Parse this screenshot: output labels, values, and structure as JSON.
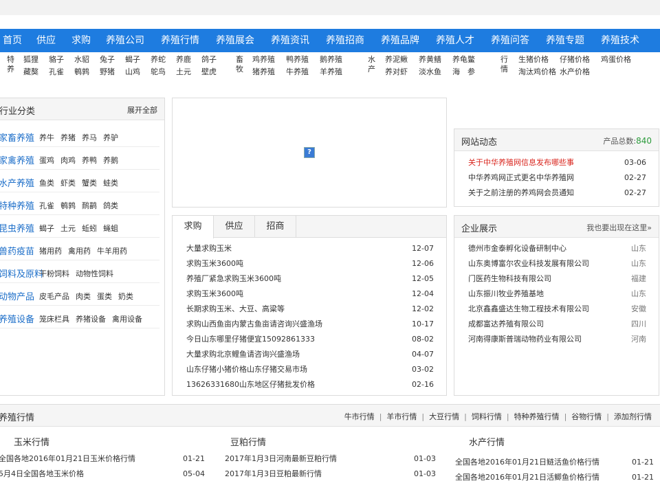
{
  "nav": [
    "首页",
    "供应",
    "求购",
    "养殖公司",
    "养殖行情",
    "养殖展会",
    "养殖资讯",
    "养殖招商",
    "养殖品牌",
    "养殖人才",
    "养殖问答",
    "养殖专题",
    "养殖技术"
  ],
  "cats": {
    "special": {
      "label": "特养",
      "row1": [
        "狐狸",
        "貉子",
        "水貂",
        "兔子",
        "蝎子",
        "养蛇",
        "养鹿",
        "鸽子"
      ],
      "row2": [
        "藏獒",
        "孔雀",
        "鹌鹑",
        "野猪",
        "山鸡",
        "鸵鸟",
        "土元",
        "壁虎"
      ]
    },
    "livestock": {
      "label": "畜牧",
      "row1": [
        "鸡养殖",
        "鸭养殖",
        "鹅养殖"
      ],
      "row2": [
        "猪养殖",
        "牛养殖",
        "羊养殖"
      ]
    },
    "aquatic": {
      "label": "水产",
      "row1": [
        "养泥鳅",
        "养黄鳝",
        "养龟鳖"
      ],
      "row2": [
        "养对虾",
        "淡水鱼",
        "海　参"
      ]
    },
    "market": {
      "label": "行情",
      "row1": [
        "生猪价格",
        "仔猪价格",
        "鸡蛋价格"
      ],
      "row2": [
        "淘汰鸡价格",
        "水产价格"
      ]
    }
  },
  "sidebar": {
    "title": "行业分类",
    "more": "展开全部",
    "rows": [
      {
        "head": "家畜养殖",
        "subs": [
          "养牛",
          "养猪",
          "养马",
          "养驴"
        ]
      },
      {
        "head": "家禽养殖",
        "subs": [
          "蛋鸡",
          "肉鸡",
          "养鸭",
          "养鹅"
        ]
      },
      {
        "head": "水产养殖",
        "subs": [
          "鱼类",
          "虾类",
          "蟹类",
          "蛙类"
        ]
      },
      {
        "head": "特种养殖",
        "subs": [
          "孔雀",
          "鹌鹑",
          "鸸鹋",
          "鸽类"
        ]
      },
      {
        "head": "昆虫养殖",
        "subs": [
          "蝎子",
          "土元",
          "蚯蚓",
          "蝇蛆"
        ]
      },
      {
        "head": "兽药疫苗",
        "subs": [
          "猪用药",
          "禽用药",
          "牛羊用药"
        ]
      },
      {
        "head": "饲料及原料",
        "subs": [
          "干粉饲料",
          "动物性饲料"
        ]
      },
      {
        "head": "动物产品",
        "subs": [
          "皮毛产品",
          "肉类",
          "蛋类",
          "奶类"
        ]
      },
      {
        "head": "养殖设备",
        "subs": [
          "笼床栏具",
          "养猪设备",
          "禽用设备"
        ]
      }
    ]
  },
  "ad": {
    "broken_image": "?"
  },
  "trade": {
    "tabs": [
      "求购",
      "供应",
      "招商"
    ],
    "items": [
      {
        "title": "大量求购玉米",
        "date": "12-07"
      },
      {
        "title": "求购玉米3600吨",
        "date": "12-06"
      },
      {
        "title": "养殖厂紧急求购玉米3600吨",
        "date": "12-05"
      },
      {
        "title": "求购玉米3600吨",
        "date": "12-04"
      },
      {
        "title": "长期求购玉米、大豆、高粱等",
        "date": "12-02"
      },
      {
        "title": "求购山西鱼亩内蒙古鱼亩请咨询兴盛渔场",
        "date": "10-17"
      },
      {
        "title": "今日山东哪里仔猪便宜15092861333",
        "date": "08-02"
      },
      {
        "title": "大量求购北京鲤鱼请咨询兴盛渔场",
        "date": "04-07"
      },
      {
        "title": "山东仔猪小猪价格山东仔猪交易市场",
        "date": "03-02"
      },
      {
        "title": "13626331680山东地区仔猪批发价格",
        "date": "02-16"
      }
    ]
  },
  "news": {
    "title": "网站动态",
    "count_label": "产品总数:",
    "count": "840",
    "items": [
      {
        "title": "关于中华养殖网信息发布哪些事",
        "date": "03-06",
        "highlight": true
      },
      {
        "title": "中华养鸡网正式更名中华养殖网",
        "date": "02-27",
        "highlight": false
      },
      {
        "title": "关于之前注册的养鸡网会员通知",
        "date": "02-27",
        "highlight": false
      }
    ]
  },
  "companies": {
    "title": "企业展示",
    "more": "我也要出现在这里»",
    "items": [
      {
        "name": "德州市金泰孵化设备研制中心",
        "region": "山东"
      },
      {
        "name": "山东奥博富尔农业科技发展有限公司",
        "region": "山东"
      },
      {
        "name": "门医药生物科技有限公司",
        "region": "福建"
      },
      {
        "name": "山东振川牧业养殖基地",
        "region": "山东"
      },
      {
        "name": "北京鑫鑫盛达生物工程技术有限公司",
        "region": "安徽"
      },
      {
        "name": "成都富达养殖有限公司",
        "region": "四川"
      },
      {
        "name": "河南得康斯普瑞动物药业有限公司",
        "region": "河南"
      }
    ]
  },
  "market": {
    "title": "养殖行情",
    "links": [
      "牛市行情",
      "羊市行情",
      "大豆行情",
      "饲料行情",
      "特种养殖行情",
      "谷物行情",
      "添加剂行情"
    ],
    "columns": [
      {
        "title": "玉米行情",
        "items": [
          {
            "title": "全国各地2016年01月21日玉米价格行情",
            "date": "01-21"
          },
          {
            "title": "5月4日全国各地玉米价格",
            "date": "05-04"
          }
        ]
      },
      {
        "title": "豆粕行情",
        "items": [
          {
            "title": "2017年1月3日河南最新豆粕行情",
            "date": "01-03"
          },
          {
            "title": "2017年1月3日豆粕最新行情",
            "date": "01-03"
          }
        ]
      },
      {
        "title": "水产行情",
        "items": [
          {
            "title": "全国各地2016年01月21日鲢活鱼价格行情",
            "date": "01-21"
          },
          {
            "title": "全国各地2016年01月21日活鲫鱼价格行情",
            "date": "01-21"
          }
        ]
      }
    ]
  },
  "colors": {
    "nav_bg": "#1e7ce0",
    "link_blue": "#1e6fc9",
    "highlight_red": "#d9251d",
    "count_green": "#2a9a3a"
  }
}
